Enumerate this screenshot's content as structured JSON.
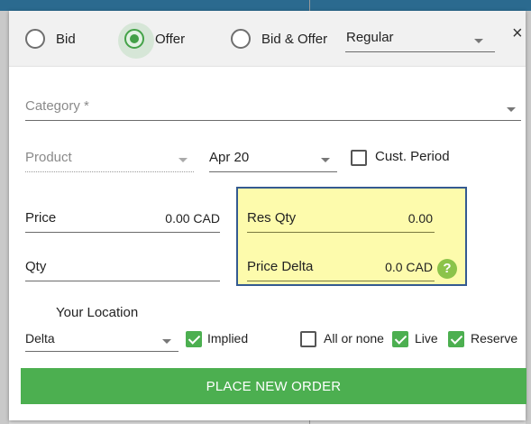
{
  "side_options": [
    {
      "label": "Bid",
      "checked": false
    },
    {
      "label": "Offer",
      "checked": true
    },
    {
      "label": "Bid & Offer",
      "checked": false
    }
  ],
  "order_type": {
    "value": "Regular"
  },
  "close_icon": "×",
  "category": {
    "label": "Category *"
  },
  "product": {
    "label": "Product"
  },
  "period": {
    "value": "Apr 20"
  },
  "cust_period": {
    "label": "Cust. Period",
    "checked": false
  },
  "price": {
    "label": "Price",
    "value": "0.00 CAD"
  },
  "qty": {
    "label": "Qty"
  },
  "res_qty": {
    "label": "Res Qty",
    "value": "0.00"
  },
  "price_delta": {
    "label": "Price Delta",
    "value": "0.0 CAD"
  },
  "help_icon": "?",
  "location": {
    "caption": "Your Location",
    "value": "Delta"
  },
  "flags": {
    "implied": {
      "label": "Implied",
      "checked": true
    },
    "all_or_none": {
      "label": "All or none",
      "checked": false
    },
    "live": {
      "label": "Live",
      "checked": true
    },
    "reserve": {
      "label": "Reserve",
      "checked": true
    }
  },
  "submit_button": {
    "label": "PLACE NEW ORDER"
  },
  "colors": {
    "accent": "#4caf50",
    "highlight": "#fdfbac",
    "highlight_border": "#345a91"
  }
}
